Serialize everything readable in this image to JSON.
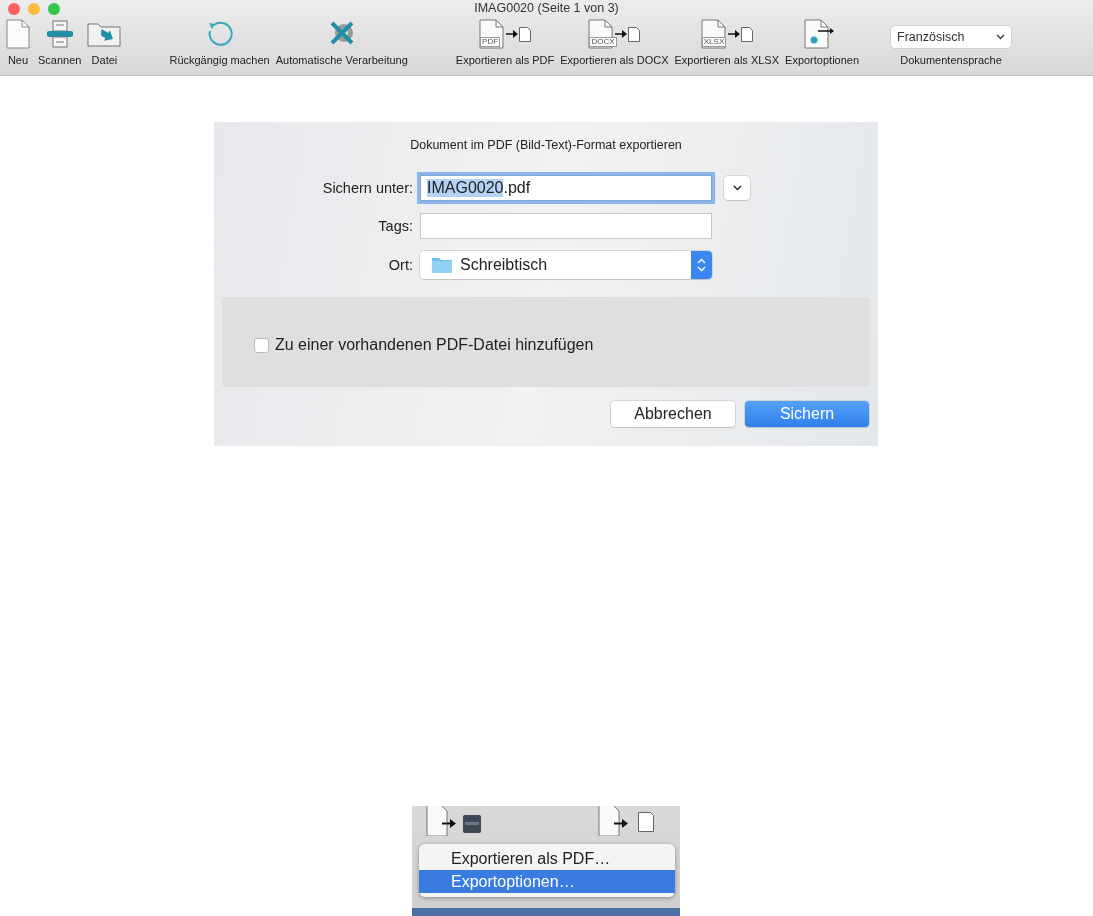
{
  "window": {
    "title": "IMAG0020 (Seite 1 von 3)"
  },
  "toolbar": {
    "items": [
      {
        "kind": "new",
        "label": "Neu"
      },
      {
        "kind": "scan",
        "label": "Scannen"
      },
      {
        "kind": "file",
        "label": "Datei"
      },
      {
        "kind": "undo",
        "label": "Rückgängig machen"
      },
      {
        "kind": "auto",
        "label": "Automatische Verarbeitung"
      },
      {
        "kind": "export",
        "format": "PDF",
        "label": "Exportieren als PDF"
      },
      {
        "kind": "export",
        "format": "DOCX",
        "label": "Exportieren als DOCX"
      },
      {
        "kind": "export",
        "format": "XLSX",
        "label": "Exportieren als XLSX"
      },
      {
        "kind": "options",
        "label": "Exportoptionen"
      }
    ],
    "language": {
      "value": "Französisch",
      "label": "Dokumentensprache"
    }
  },
  "dialog": {
    "title": "Dokument im PDF (Bild-Text)-Format exportieren",
    "fields": [
      {
        "kind": "text",
        "label": "Sichern unter:",
        "focused": true,
        "value_parts": [
          {
            "text": "IMAG0020",
            "selected": true
          },
          {
            "text": ".pdf",
            "selected": false
          }
        ]
      },
      {
        "kind": "text",
        "label": "Tags:",
        "focused": false
      },
      {
        "kind": "popup",
        "label": "Ort:",
        "value": "Schreibtisch"
      }
    ],
    "checkbox": {
      "label": "Zu einer vorhandenen PDF-Datei hinzufügen",
      "checked": false
    },
    "buttons": [
      {
        "label": "Abbrechen",
        "default": false
      },
      {
        "label": "Sichern",
        "default": true
      }
    ]
  },
  "menu_snippet": {
    "items": [
      {
        "label": "Exportieren als PDF…",
        "selected": false
      },
      {
        "label": "Exportoptionen…",
        "selected": true
      }
    ]
  }
}
